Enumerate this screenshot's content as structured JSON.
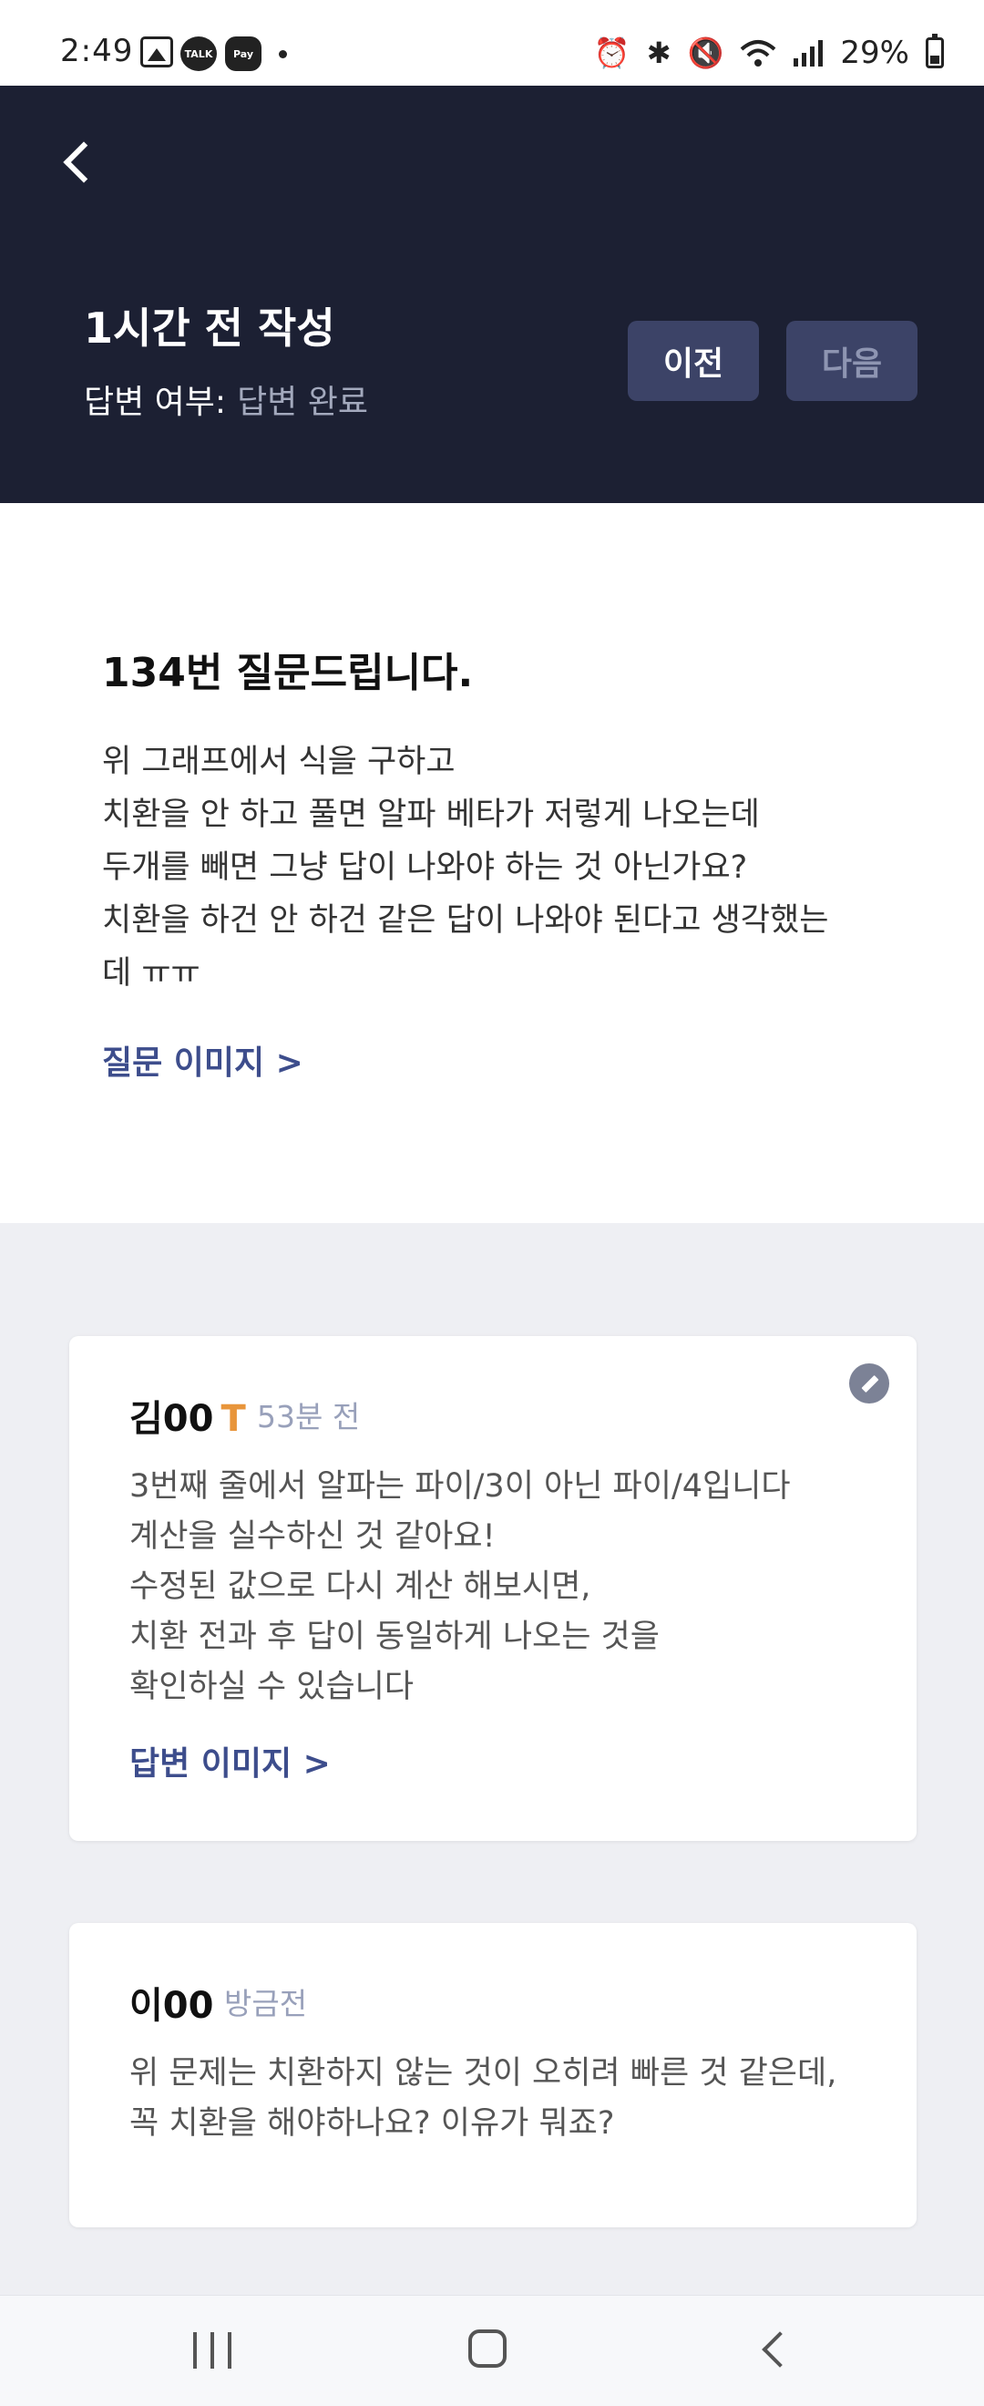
{
  "status_bar": {
    "time": "2:49",
    "talk_label": "TALK",
    "pay_label": "Pay",
    "battery": "29%",
    "icons": [
      "gallery-icon",
      "kakaotalk-icon",
      "kakaopay-icon",
      "alarm-icon",
      "bluetooth-icon",
      "mute-icon",
      "wifi-icon",
      "signal-icon",
      "battery-icon"
    ]
  },
  "header": {
    "time_label": "1시간 전 작성",
    "status_label": "답변 여부:",
    "status_value": "답변 완료",
    "prev_label": "이전",
    "next_label": "다음"
  },
  "question": {
    "title": "134번 질문드립니다.",
    "body": [
      "위 그래프에서 식을 구하고",
      "치환을 안 하고 풀면 알파 베타가 저렇게 나오는데",
      "두개를 빼면 그냥 답이 나와야 하는 것 아닌가요?",
      "치환을 하건 안 하건 같은 답이 나와야 된다고 생각했는",
      "데 ㅠㅠ"
    ],
    "image_link": "질문 이미지 >"
  },
  "answers": [
    {
      "author": "김00",
      "badge": "T",
      "time": "53분 전",
      "body": [
        "3번째 줄에서 알파는 파이/3이 아닌 파이/4입니다",
        "계산을 실수하신 것 같아요!",
        "수정된 값으로 다시 계산 해보시면,",
        "치환 전과 후 답이 동일하게 나오는 것을",
        "확인하실 수 있습니다"
      ],
      "image_link": "답변 이미지 >"
    },
    {
      "author": "이00",
      "time": "방금전",
      "body": [
        "위 문제는 치환하지 않는 것이 오히려 빠른 것 같은데,",
        "꼭 치환을 해야하나요? 이유가 뭐죠?"
      ]
    }
  ],
  "colors": {
    "header_bg": "#1c2033",
    "button_bg": "#3c4367",
    "link": "#3d4d8c",
    "badge": "#e8953b",
    "page_bg": "#eeeff3"
  }
}
